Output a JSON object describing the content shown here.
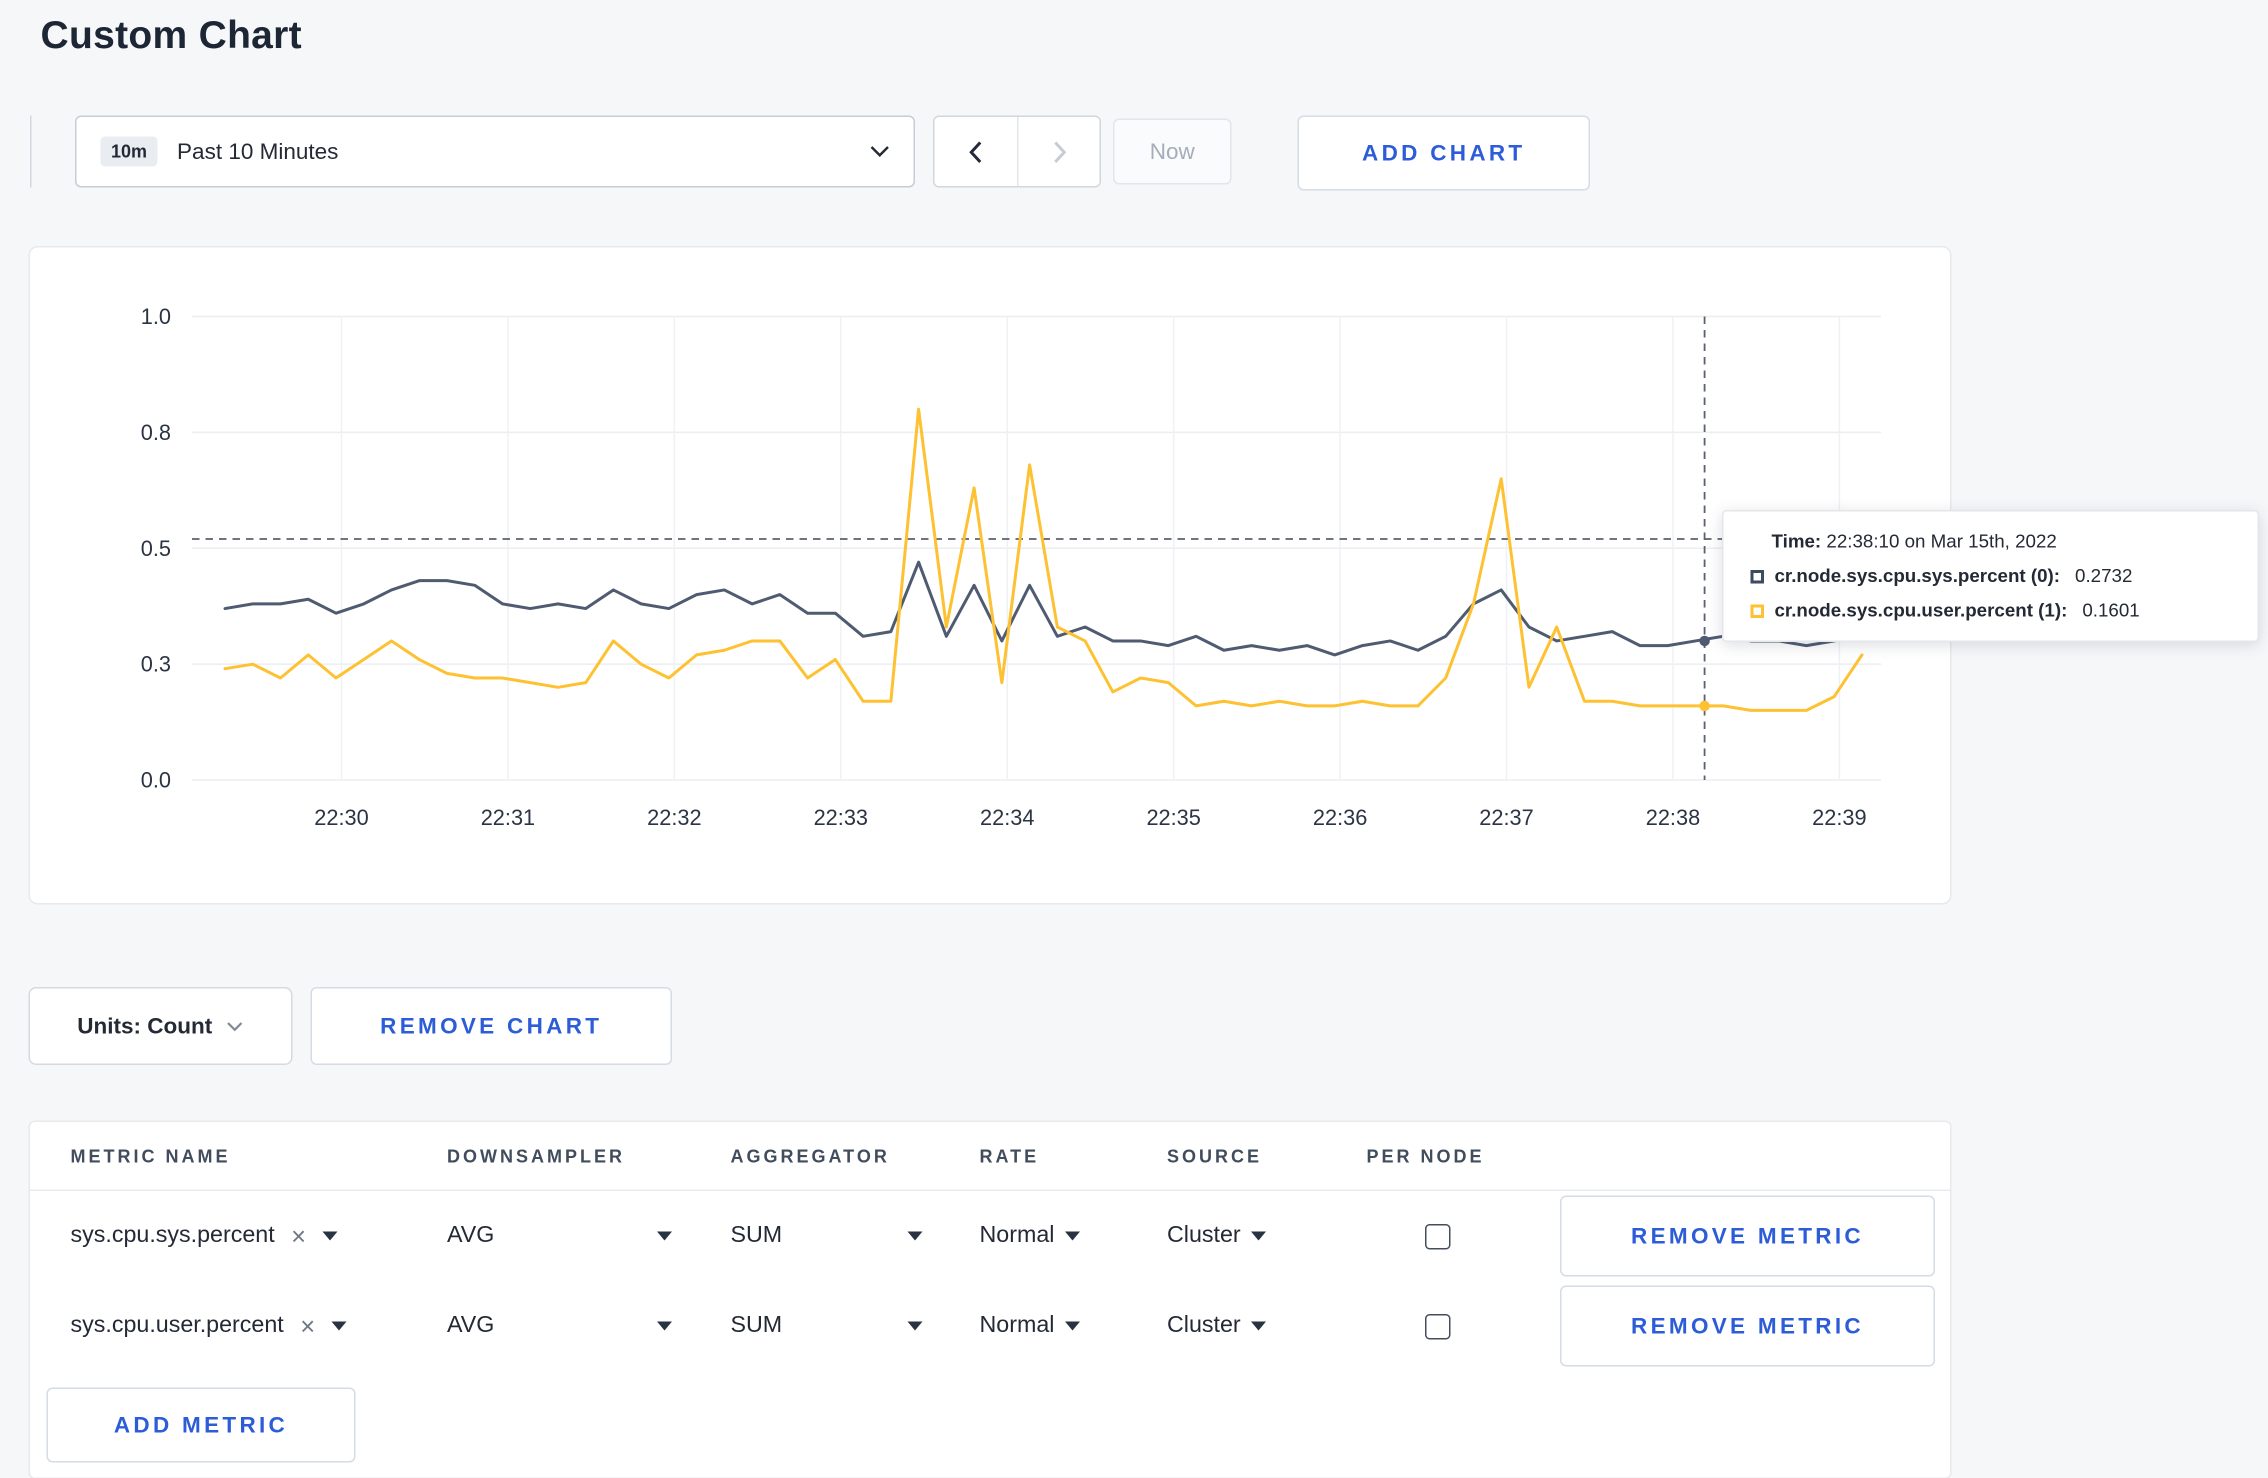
{
  "page": {
    "title": "Custom Chart"
  },
  "colors": {
    "accent": "#2c5cd7"
  },
  "toolbar": {
    "time_badge": "10m",
    "time_selected": "Past 10 Minutes",
    "now_label": "Now",
    "add_chart_label": "ADD CHART"
  },
  "tooltip": {
    "time_label": "Time:",
    "time_value": "22:38:10 on Mar 15th, 2022",
    "entries": [
      {
        "label": "cr.node.sys.cpu.sys.percent (0):",
        "value": "0.2732",
        "color": "#3e4a5e"
      },
      {
        "label": "cr.node.sys.cpu.user.percent (1):",
        "value": "0.1601",
        "color": "#fdc132"
      }
    ]
  },
  "chart_controls": {
    "units_label": "Units: Count",
    "remove_chart_label": "REMOVE CHART",
    "add_metric_label": "ADD METRIC"
  },
  "metrics_table": {
    "headers": [
      "METRIC NAME",
      "DOWNSAMPLER",
      "AGGREGATOR",
      "RATE",
      "SOURCE",
      "PER NODE"
    ],
    "rows": [
      {
        "metric": "sys.cpu.sys.percent",
        "downsampler": "AVG",
        "aggregator": "SUM",
        "rate": "Normal",
        "source": "Cluster",
        "per_node_checked": false,
        "remove_label": "REMOVE METRIC"
      },
      {
        "metric": "sys.cpu.user.percent",
        "downsampler": "AVG",
        "aggregator": "SUM",
        "rate": "Normal",
        "source": "Cluster",
        "per_node_checked": false,
        "remove_label": "REMOVE METRIC"
      }
    ]
  },
  "chart_data": {
    "type": "line",
    "title": "",
    "xlabel": "",
    "ylabel": "",
    "ylim": [
      0,
      1
    ],
    "yticks": [
      0,
      0.25,
      0.5,
      0.75,
      1.0
    ],
    "ytick_labels": [
      "0.0",
      "0.3",
      "0.5",
      "0.8",
      "1.0"
    ],
    "xlim_minutes": [
      29.3,
      39.25
    ],
    "xticks_minutes": [
      30,
      31,
      32,
      33,
      34,
      35,
      36,
      37,
      38,
      39
    ],
    "xtick_labels": [
      "22:30",
      "22:31",
      "22:32",
      "22:33",
      "22:34",
      "22:35",
      "22:36",
      "22:37",
      "22:38",
      "22:39"
    ],
    "grid": true,
    "legend_position": "tooltip-right",
    "x_start_minutes": 29.3,
    "x_step_minutes": 0.1667,
    "hover": {
      "x_minutes": 38.19,
      "hline_value": 0.52,
      "point_values": [
        0.3,
        0.16
      ]
    },
    "series": [
      {
        "name": "cr.node.sys.cpu.sys.percent",
        "color": "#4f5b70",
        "values": [
          0.37,
          0.38,
          0.38,
          0.39,
          0.36,
          0.38,
          0.41,
          0.43,
          0.43,
          0.42,
          0.38,
          0.37,
          0.38,
          0.37,
          0.41,
          0.38,
          0.37,
          0.4,
          0.41,
          0.38,
          0.4,
          0.36,
          0.36,
          0.31,
          0.32,
          0.47,
          0.31,
          0.42,
          0.3,
          0.42,
          0.31,
          0.33,
          0.3,
          0.3,
          0.29,
          0.31,
          0.28,
          0.29,
          0.28,
          0.29,
          0.27,
          0.29,
          0.3,
          0.28,
          0.31,
          0.38,
          0.41,
          0.33,
          0.3,
          0.31,
          0.32,
          0.29,
          0.29,
          0.3,
          0.31,
          0.3,
          0.3,
          0.29,
          0.3,
          0.31
        ]
      },
      {
        "name": "cr.node.sys.cpu.user.percent",
        "color": "#fdc132",
        "values": [
          0.24,
          0.25,
          0.22,
          0.27,
          0.22,
          0.26,
          0.3,
          0.26,
          0.23,
          0.22,
          0.22,
          0.21,
          0.2,
          0.21,
          0.3,
          0.25,
          0.22,
          0.27,
          0.28,
          0.3,
          0.3,
          0.22,
          0.26,
          0.17,
          0.17,
          0.8,
          0.33,
          0.63,
          0.21,
          0.68,
          0.33,
          0.3,
          0.19,
          0.22,
          0.21,
          0.16,
          0.17,
          0.16,
          0.17,
          0.16,
          0.16,
          0.17,
          0.16,
          0.16,
          0.22,
          0.38,
          0.65,
          0.2,
          0.33,
          0.17,
          0.17,
          0.16,
          0.16,
          0.16,
          0.16,
          0.15,
          0.15,
          0.15,
          0.18,
          0.27
        ]
      }
    ]
  }
}
